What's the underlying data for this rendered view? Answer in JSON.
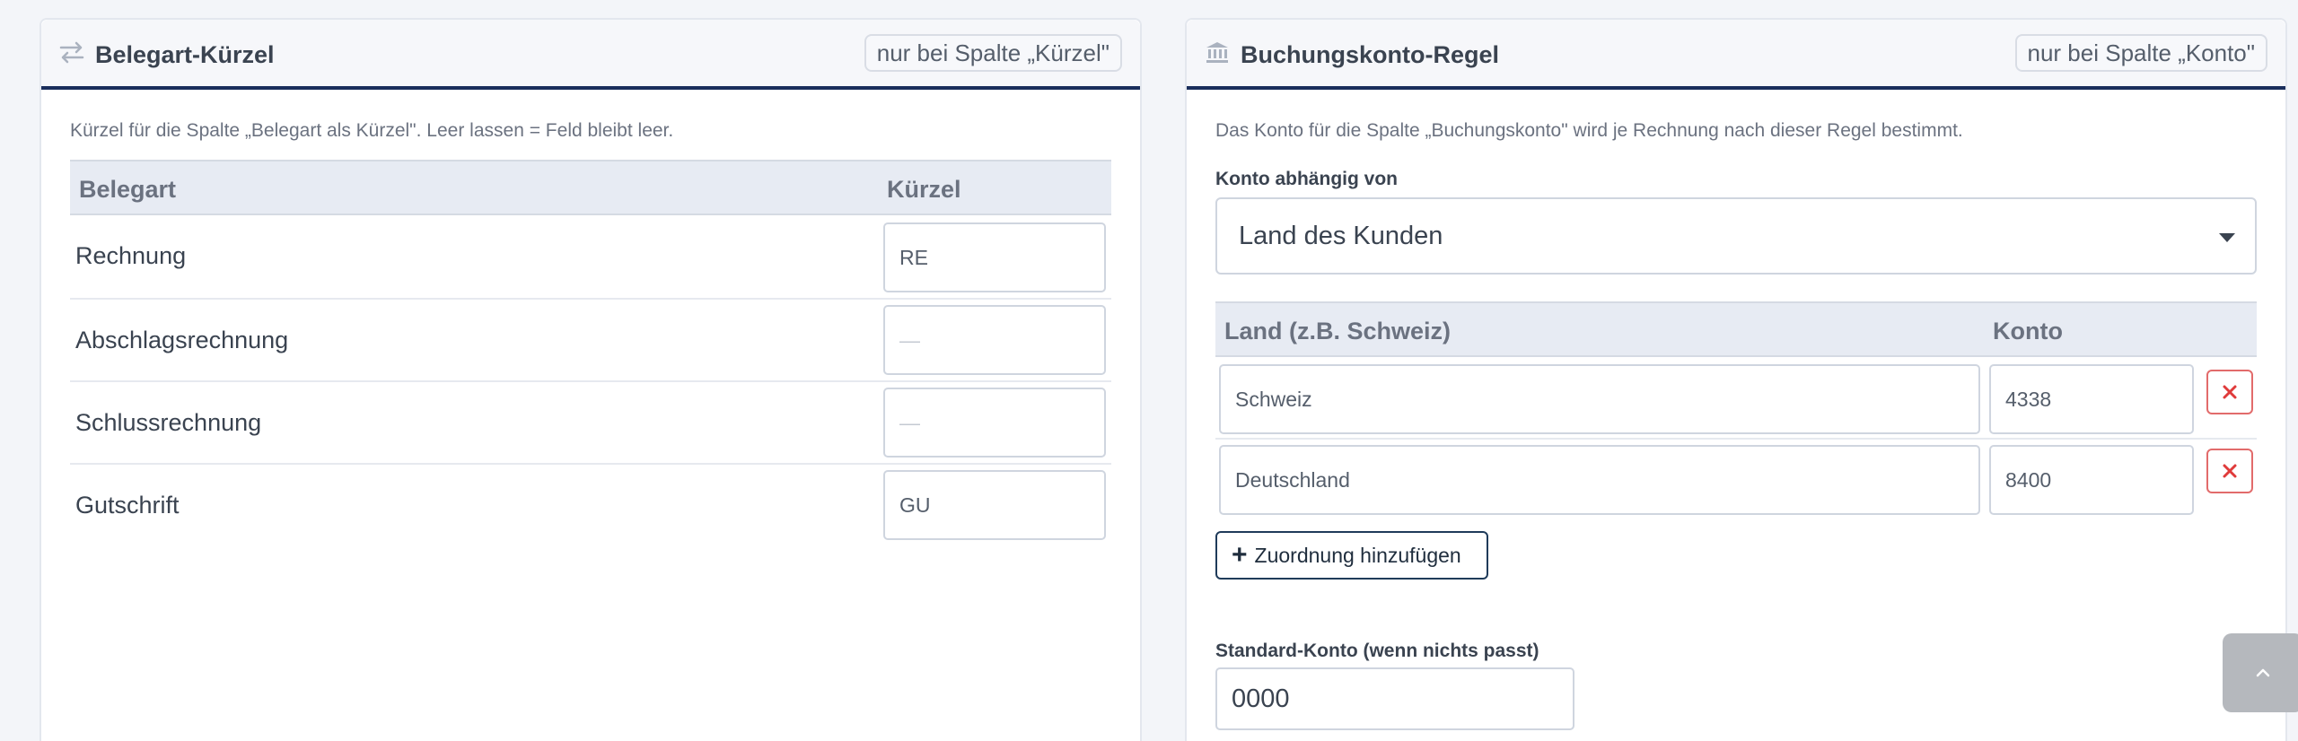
{
  "left_card": {
    "title": "Belegart-Kürzel",
    "header_icon": "arrows-exchange-icon",
    "badge": "nur bei Spalte „Kürzel\"",
    "hint": "Kürzel für die Spalte „Belegart als Kürzel\". Leer lassen = Feld bleibt leer.",
    "columns": [
      "Belegart",
      "Kürzel"
    ],
    "rows": [
      {
        "label": "Rechnung",
        "value": "RE",
        "placeholder": ""
      },
      {
        "label": "Abschlagsrechnung",
        "value": "",
        "placeholder": "—"
      },
      {
        "label": "Schlussrechnung",
        "value": "",
        "placeholder": "—"
      },
      {
        "label": "Gutschrift",
        "value": "GU",
        "placeholder": ""
      }
    ]
  },
  "right_card": {
    "title": "Buchungskonto-Regel",
    "header_icon": "bank-icon",
    "badge": "nur bei Spalte „Konto\"",
    "hint": "Das Konto für die Spalte „Buchungskonto\" wird je Rechnung nach dieser Regel bestimmt.",
    "dependency_label": "Konto abhängig von",
    "dependency_value": "Land des Kunden",
    "columns": [
      "Land (z.B. Schweiz)",
      "Konto"
    ],
    "mappings": [
      {
        "land": "Schweiz",
        "konto": "4338"
      },
      {
        "land": "Deutschland",
        "konto": "8400"
      }
    ],
    "add_button": "Zuordnung hinzufügen",
    "default_label": "Standard-Konto (wenn nichts passt)",
    "default_value": "0000"
  },
  "colors": {
    "accent": "#1a2e5c",
    "delete": "#e26b6b",
    "header_bg": "#f6f7fa",
    "table_head_bg": "#e7ebf3"
  },
  "scroll_top_icon": "chevron-up-icon"
}
